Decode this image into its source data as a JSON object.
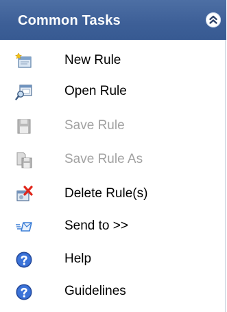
{
  "panel": {
    "title": "Common Tasks",
    "collapse_icon": "chevron-double-up-icon"
  },
  "items": [
    {
      "label": "New Rule",
      "icon": "new-rule-icon",
      "enabled": true
    },
    {
      "label": "Open Rule",
      "icon": "open-rule-icon",
      "enabled": true
    },
    {
      "label": "Save Rule",
      "icon": "save-icon",
      "enabled": false
    },
    {
      "label": "Save Rule As",
      "icon": "save-as-icon",
      "enabled": false
    },
    {
      "label": "Delete Rule(s)",
      "icon": "delete-icon",
      "enabled": true
    },
    {
      "label": "Send to >>",
      "icon": "send-to-icon",
      "enabled": true
    },
    {
      "label": "Help",
      "icon": "help-icon",
      "enabled": true
    },
    {
      "label": "Guidelines",
      "icon": "guidelines-icon",
      "enabled": true
    }
  ]
}
